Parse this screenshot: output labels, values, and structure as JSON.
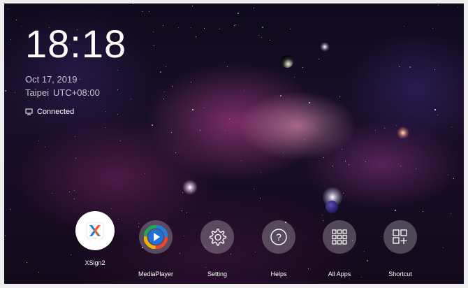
{
  "clock": {
    "time": "18:18"
  },
  "date": {
    "text": "Oct 17, 2019"
  },
  "timezone": {
    "city": "Taipei",
    "offset": "UTC+08:00"
  },
  "network": {
    "status": "Connected",
    "icon": "monitor-icon"
  },
  "dock": {
    "apps": [
      {
        "label": "XSign2",
        "icon": "xsign-icon",
        "selected": true
      },
      {
        "label": "MediaPlayer",
        "icon": "play-icon",
        "selected": false
      },
      {
        "label": "Setting",
        "icon": "gear-icon",
        "selected": false
      },
      {
        "label": "Helps",
        "icon": "help-icon",
        "selected": false
      },
      {
        "label": "All Apps",
        "icon": "grid-icon",
        "selected": false
      },
      {
        "label": "Shortcut",
        "icon": "add-shortcut-icon",
        "selected": false
      }
    ]
  },
  "colors": {
    "xsign_accent": "#ff5a1f",
    "xsign_blue": "#1f7fe0",
    "xsign_gray": "#6b7a8f"
  }
}
